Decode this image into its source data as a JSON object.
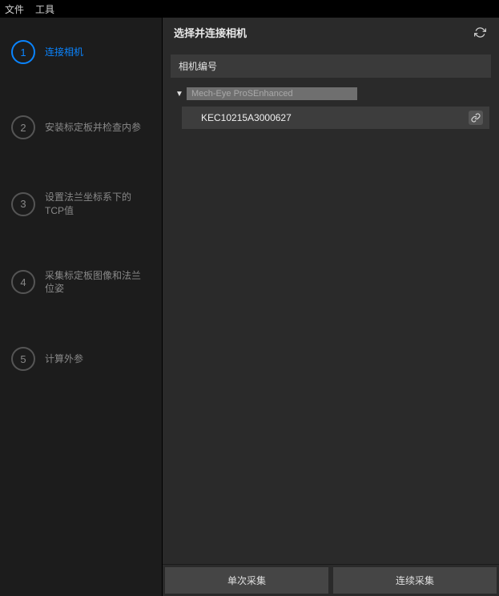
{
  "menubar": {
    "file": "文件",
    "tools": "工具"
  },
  "sidebar": {
    "steps": [
      {
        "num": "1",
        "label": "连接相机",
        "active": true
      },
      {
        "num": "2",
        "label": "安装标定板并检查内参",
        "active": false
      },
      {
        "num": "3",
        "label": "设置法兰坐标系下的TCP值",
        "active": false
      },
      {
        "num": "4",
        "label": "采集标定板图像和法兰位姿",
        "active": false
      },
      {
        "num": "5",
        "label": "计算外参",
        "active": false
      }
    ]
  },
  "content": {
    "title": "选择并连接相机",
    "section_header": "相机编号",
    "group_label": "Mech-Eye ProSEnhanced",
    "camera_id": "KEC10215A3000627"
  },
  "footer": {
    "single_capture": "单次采集",
    "continuous_capture": "连续采集"
  }
}
